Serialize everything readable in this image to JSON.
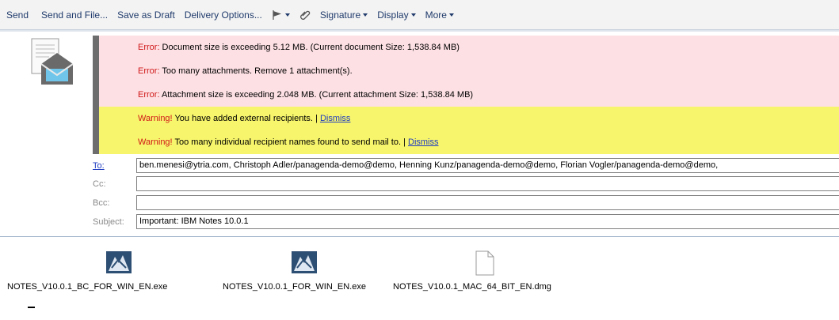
{
  "toolbar": {
    "send": "Send",
    "send_and_file": "Send and File...",
    "save_as_draft": "Save as Draft",
    "delivery_options": "Delivery Options...",
    "signature": "Signature",
    "display": "Display",
    "more": "More"
  },
  "messages": [
    {
      "keyword": "Error:",
      "text": " Document size is exceeding 5.12 MB. (Current document Size: 1,538.84 MB)",
      "type": "error"
    },
    {
      "keyword": "Error:",
      "text": " Too many attachments. Remove 1 attachment(s).",
      "type": "error"
    },
    {
      "keyword": "Error:",
      "text": " Attachment size is exceeding 2.048 MB. (Current attachment Size: 1,538.84 MB)",
      "type": "error"
    },
    {
      "keyword": "Warning!",
      "text": " You have added external recipients.  | ",
      "link": "Dismiss",
      "type": "warning"
    },
    {
      "keyword": "Warning!",
      "text": " Too many individual recipient names found to send mail to.  | ",
      "link": "Dismiss",
      "type": "warning"
    }
  ],
  "fields": {
    "to_label": "To:",
    "to_value": "ben.menesi@ytria.com, Christoph Adler/panagenda-demo@demo, Henning Kunz/panagenda-demo@demo, Florian Vogler/panagenda-demo@demo,",
    "cc_label": "Cc:",
    "cc_value": "",
    "bcc_label": "Bcc:",
    "bcc_value": "",
    "subject_label": "Subject:",
    "subject_value": "Important: IBM Notes 10.0.1"
  },
  "attachments": [
    {
      "name": "NOTES_V10.0.1_BC_FOR_WIN_EN.exe",
      "icon": "installer-icon"
    },
    {
      "name": "NOTES_V10.0.1_FOR_WIN_EN.exe",
      "icon": "installer-icon"
    },
    {
      "name": "NOTES_V10.0.1_MAC_64_BIT_EN.dmg",
      "icon": "file-icon"
    }
  ],
  "colors": {
    "error_bg": "#fde0e4",
    "warning_bg": "#f7f56b",
    "keyword": "#d01818",
    "link": "#1f3cc0"
  }
}
